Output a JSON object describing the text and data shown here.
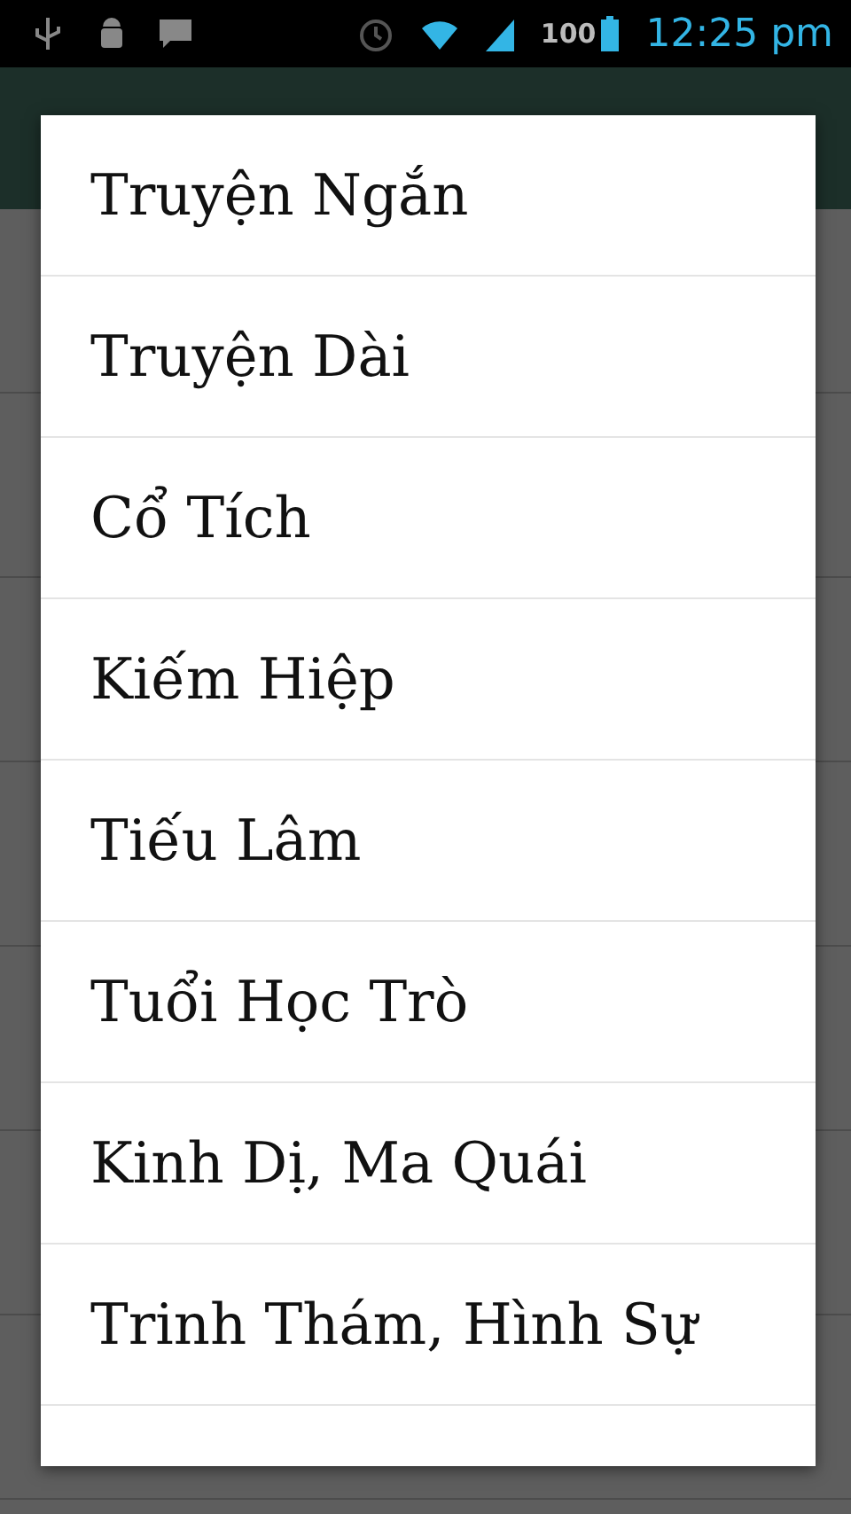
{
  "status_bar": {
    "battery_text": "100",
    "time": "12:25 pm"
  },
  "menu": {
    "items": [
      {
        "label": "Truyện Ngắn"
      },
      {
        "label": "Truyện Dài"
      },
      {
        "label": "Cổ Tích"
      },
      {
        "label": "Kiếm Hiệp"
      },
      {
        "label": "Tiếu Lâm"
      },
      {
        "label": "Tuổi Học Trò"
      },
      {
        "label": "Kinh Dị, Ma Quái"
      },
      {
        "label": "Trinh Thám, Hình Sự"
      }
    ]
  }
}
